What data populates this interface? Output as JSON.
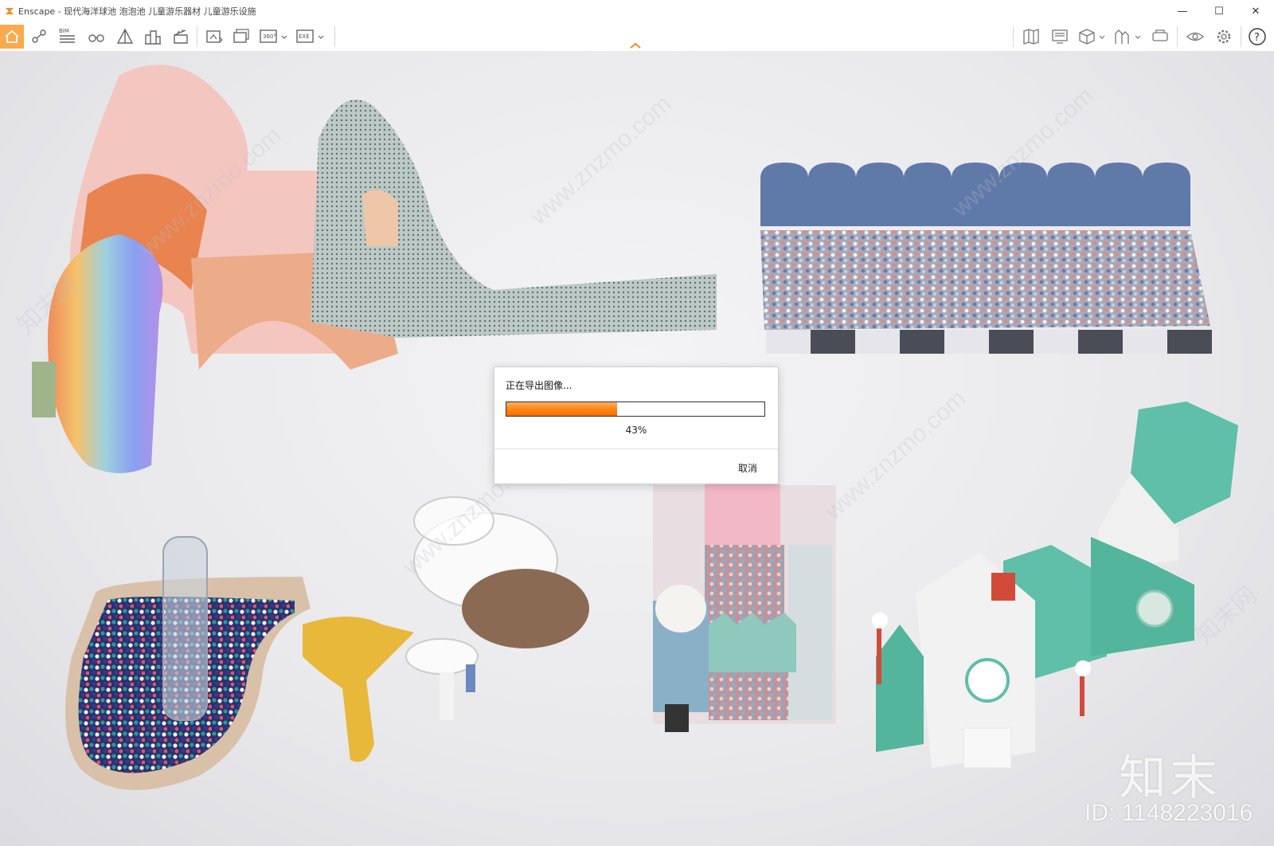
{
  "window": {
    "title": "Enscape - 现代海洋球池 泡泡池 儿童游乐器材 儿童游乐设施",
    "controls": {
      "minimize": "—",
      "maximize": "☐",
      "close": "✕"
    }
  },
  "toolbar": {
    "left_tools": [
      "home-icon",
      "path-icon",
      "bim-icon",
      "binoculars-icon",
      "perspective-icon",
      "buildings-icon",
      "clapper-icon",
      "screenshot-icon",
      "batch-render-icon",
      "panorama-360-icon",
      "export-exe-icon"
    ],
    "bim_label": "BIM",
    "panorama_label": "360°",
    "exe_label": "EXE",
    "right_tools": [
      "map-icon",
      "display-icon",
      "cube-icon",
      "asset-library-icon",
      "vr-headset-icon",
      "eye-icon",
      "gear-icon",
      "help-icon"
    ],
    "accent_color": "#fba94d"
  },
  "export_dialog": {
    "title": "正在导出图像...",
    "progress": 0.43,
    "percent_text": "43%",
    "cancel_label": "取消",
    "progress_color": "#ff8a1a"
  },
  "watermark": {
    "logo_text": "知末",
    "id_text": "ID: 1148223016",
    "diagonal_texts": [
      "www.znzmo.com",
      "www.znzmo.com",
      "www.znzmo.com",
      "www.znzmo.com",
      "www.znzmo.com",
      "知末网",
      "知末网"
    ]
  }
}
